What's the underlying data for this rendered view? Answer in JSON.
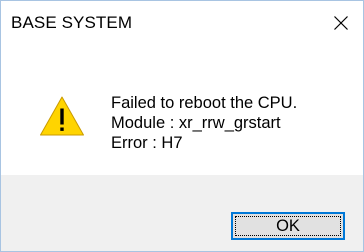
{
  "window": {
    "title": "BASE SYSTEM",
    "close_icon": "close-icon"
  },
  "message": {
    "icon": "warning-icon",
    "lines": [
      "Failed to reboot the CPU.",
      "Module : xr_rrw_grstart",
      "Error : H7"
    ]
  },
  "buttons": {
    "ok_label": "OK"
  },
  "colors": {
    "accent": "#0078d7",
    "warning_fill": "#ffd400",
    "footer_bg": "#f0f0f0",
    "border": "#a8c4e2"
  }
}
